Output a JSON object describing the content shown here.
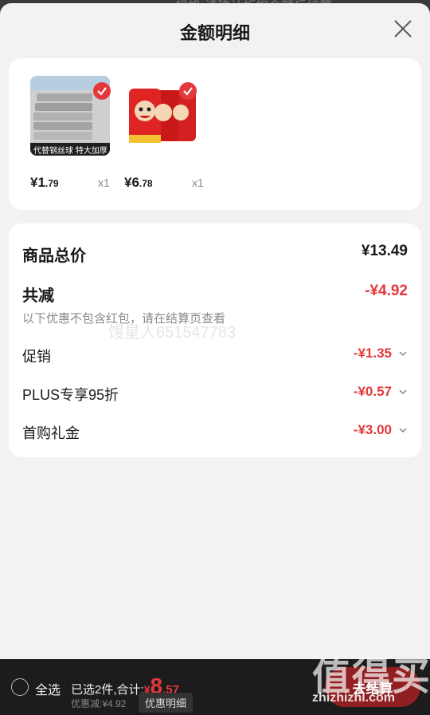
{
  "header": {
    "title": "金额明细",
    "background_text": "规格·请确认折扣金额后结算"
  },
  "products": [
    {
      "price_int": "¥1",
      "price_dec": ".79",
      "qty": "x1",
      "image": "steel-wool-cloth-product",
      "thumb_text": "代替钢丝球 特大加厚"
    },
    {
      "price_int": "¥6",
      "price_dec": ".78",
      "qty": "x1",
      "image": "wangzai-milk-cans-product"
    }
  ],
  "summary": {
    "total_label": "商品总价",
    "total_value": "¥13.49",
    "reduce_label": "共减",
    "reduce_value": "-¥4.92",
    "note": "以下优惠不包含红包，请在结算页查看",
    "watermark": "馒星人651547783"
  },
  "discounts": [
    {
      "label": "促销",
      "value": "-¥1.35"
    },
    {
      "label": "PLUS专享95折",
      "value": "-¥0.57"
    },
    {
      "label": "首购礼金",
      "value": "-¥3.00"
    }
  ],
  "bottom_bar": {
    "select_all": "全选",
    "selected_text": "已选2件,合计:",
    "amount_yen": "¥",
    "amount_int": "8",
    "amount_dec": ".57",
    "saved_text": "优惠减:¥4.92",
    "detail_button": "优惠明细",
    "checkout_button": "去结算"
  },
  "site_watermark": {
    "cn": "值得买",
    "en": "zhizhizhi.com"
  },
  "colors": {
    "accent": "#e4393c",
    "sheet_bg": "#f2f2f2",
    "bar_bg": "#1c1c1c"
  }
}
